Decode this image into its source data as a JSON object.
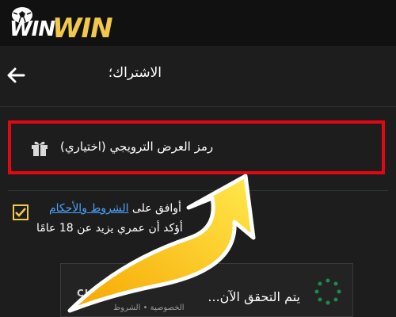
{
  "logo": {
    "part1": "WIN",
    "part2": "WIN"
  },
  "header": {
    "title": "الاشتراك؛"
  },
  "promo": {
    "label": "رمز العرض الترويجي (اختياري)"
  },
  "terms": {
    "prefix": "أوافق على ",
    "link": "الشروط والأحكام",
    "line2": "أؤكد أن عمري يزيد عن 18 عامًا"
  },
  "captcha": {
    "status": "يتم التحقق الآن...",
    "brand": "CLOUD",
    "links": "الخصوصية • الشروط"
  },
  "colors": {
    "accent": "#f2c84b",
    "highlight": "#e30613",
    "link": "#4aa3ff",
    "background": "#1d1d1d"
  }
}
